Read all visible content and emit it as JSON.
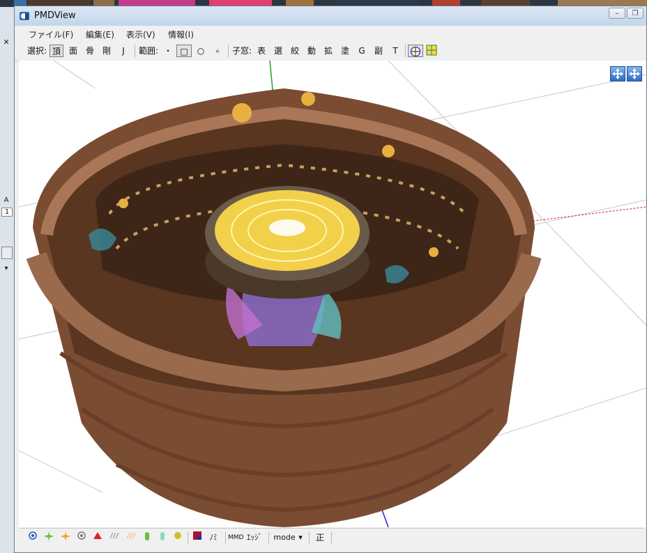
{
  "window": {
    "title": "PMDView"
  },
  "window_controls": {
    "minimize": "–",
    "restore": "❐"
  },
  "left_pane": {
    "label_a": "A",
    "value": "1"
  },
  "menu": [
    {
      "label": "ファイル(F)"
    },
    {
      "label": "編集(E)"
    },
    {
      "label": "表示(V)"
    },
    {
      "label": "情報(I)"
    }
  ],
  "toolbar": {
    "select_label": "選択:",
    "select_items": [
      "頂",
      "面",
      "骨",
      "剛",
      "J"
    ],
    "range_label": "範囲:",
    "range_items": [
      "・",
      "□",
      "○",
      "▵"
    ],
    "child_window_label": "子窓:",
    "child_items": [
      "表",
      "選",
      "絞",
      "動",
      "拡",
      "塗",
      "G",
      "副",
      "T"
    ]
  },
  "statusbar": {
    "mm_label": "MMD",
    "edge_label": "ｴｯｼﾞ",
    "mode_label": "mode",
    "mode_arrow": "▾",
    "persp_label": "正",
    "misc_label": "ﾉﾐ"
  },
  "colors": {
    "axis_red": "#e02020",
    "axis_green": "#20a020",
    "axis_blue": "#2020e0",
    "wood": "#8a5a3c",
    "gold": "#f2d04a"
  }
}
